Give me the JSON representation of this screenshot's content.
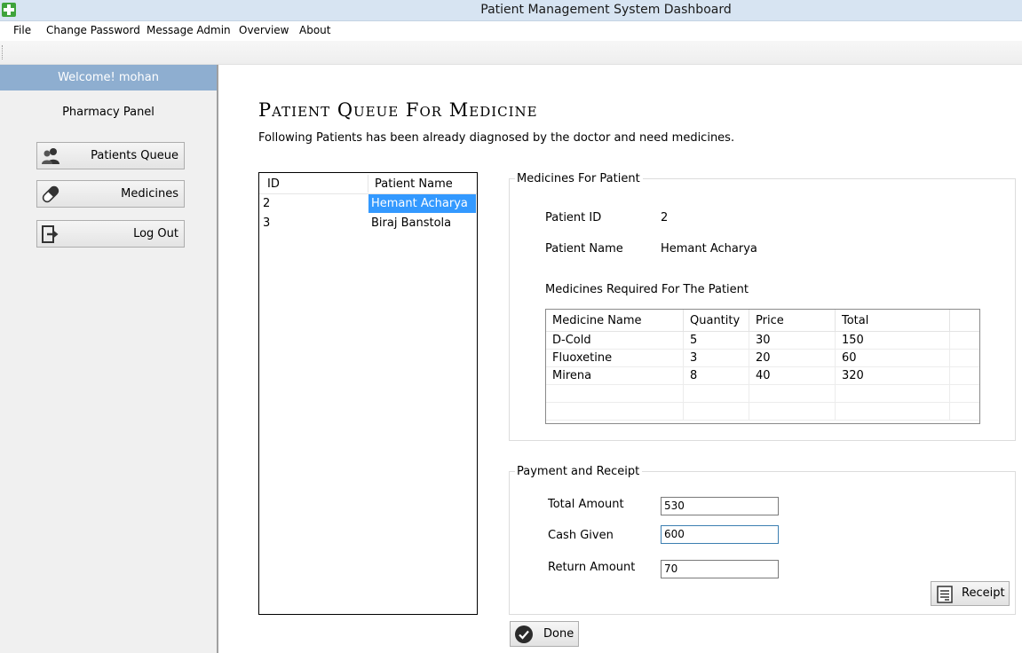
{
  "window": {
    "title": "Patient Management System Dashboard"
  },
  "menu": [
    "File",
    "Change Password",
    "Message Admin",
    "Overview",
    "About"
  ],
  "sidebar": {
    "welcome": "Welcome! mohan",
    "panel_title": "Pharmacy Panel",
    "buttons": [
      {
        "label": "Patients Queue",
        "icon": "users-icon"
      },
      {
        "label": "Medicines",
        "icon": "pill-icon"
      },
      {
        "label": "Log Out",
        "icon": "logout-icon"
      }
    ]
  },
  "main": {
    "title": "Patient Queue For Medicine",
    "subtitle": "Following Patients has been already diagnosed by the doctor and need medicines."
  },
  "patient_list": {
    "headers": [
      "ID",
      "Patient Name"
    ],
    "rows": [
      {
        "id": "2",
        "name": "Hemant Acharya",
        "selected": true
      },
      {
        "id": "3",
        "name": "Biraj Banstola",
        "selected": false
      }
    ]
  },
  "medicines_group": {
    "title": "Medicines For Patient",
    "patient_id_label": "Patient ID",
    "patient_id_value": "2",
    "patient_name_label": "Patient Name",
    "patient_name_value": "Hemant Acharya",
    "required_label": "Medicines Required For The Patient",
    "table": {
      "headers": [
        "Medicine Name",
        "Quantity",
        "Price",
        "Total"
      ],
      "rows": [
        [
          "D-Cold",
          "5",
          "30",
          "150"
        ],
        [
          "Fluoxetine",
          "3",
          "20",
          "60"
        ],
        [
          "Mirena",
          "8",
          "40",
          "320"
        ]
      ]
    }
  },
  "payment_group": {
    "title": "Payment and Receipt",
    "total_amount_label": "Total Amount",
    "total_amount_value": "530",
    "cash_given_label": "Cash Given",
    "cash_given_value": "600",
    "return_amount_label": "Return Amount",
    "return_amount_value": "70",
    "receipt_label": "Receipt"
  },
  "done_label": "Done"
}
